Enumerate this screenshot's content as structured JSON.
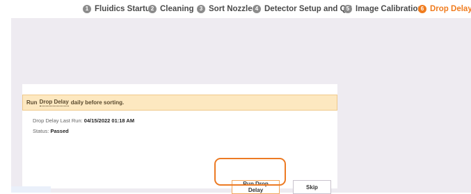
{
  "stepper": {
    "steps": [
      {
        "num": "1",
        "label": "Fluidics Startup"
      },
      {
        "num": "2",
        "label": "Cleaning"
      },
      {
        "num": "3",
        "label": "Sort Nozzle"
      },
      {
        "num": "4",
        "label": "Detector Setup and QC"
      },
      {
        "num": "5",
        "label": "Image Calibration"
      },
      {
        "num": "6",
        "label": "Drop Delay"
      }
    ],
    "active_color": "#f07c1e"
  },
  "banner": {
    "prefix": "Run",
    "link_text": "Drop Delay",
    "suffix": "daily before sorting."
  },
  "info": {
    "last_run_label": "Drop Delay Last Run:",
    "last_run_value": "04/15/2022 01:18 AM",
    "status_label": "Status:",
    "status_value": "Passed"
  },
  "buttons": {
    "run": "Run Drop Delay",
    "skip": "Skip"
  }
}
